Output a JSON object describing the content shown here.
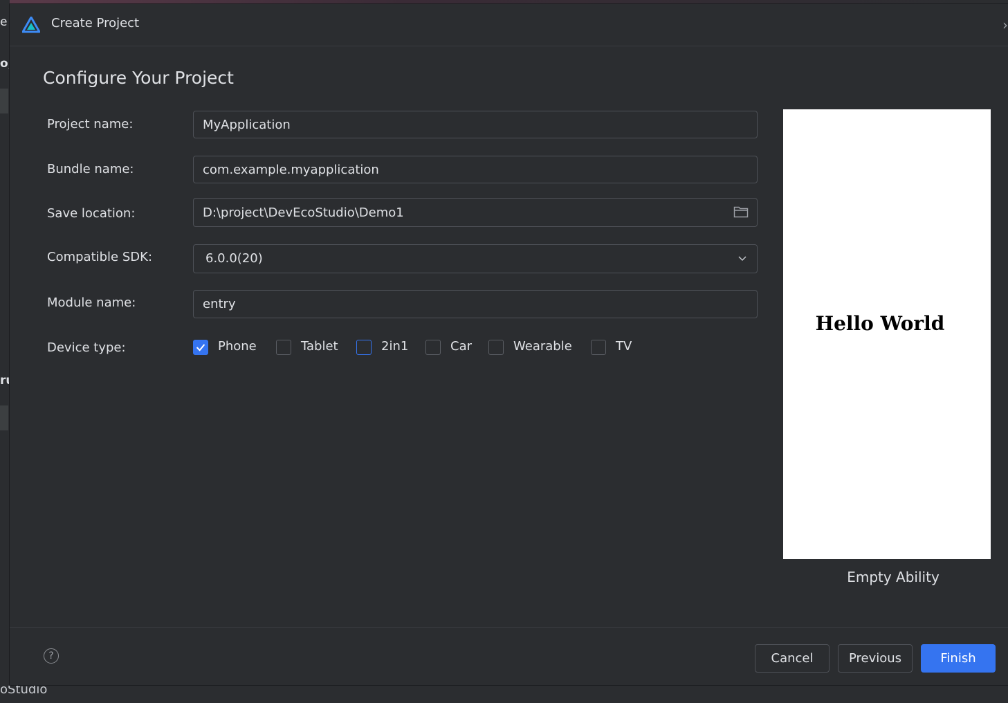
{
  "background": {
    "fragments": [
      "e",
      "o,",
      "ru"
    ],
    "status_text": "oStudio"
  },
  "dialog": {
    "title": "Create Project",
    "heading": "Configure Your Project",
    "form": {
      "project_name": {
        "label": "Project name:",
        "value": "MyApplication"
      },
      "bundle_name": {
        "label": "Bundle name:",
        "value": "com.example.myapplication"
      },
      "save_location": {
        "label": "Save location:",
        "value": "D:\\project\\DevEcoStudio\\Demo1"
      },
      "compatible_sdk": {
        "label": "Compatible SDK:",
        "value": "6.0.0(20)"
      },
      "module_name": {
        "label": "Module name:",
        "value": "entry"
      },
      "device_type": {
        "label": "Device type:",
        "options": [
          {
            "label": "Phone",
            "checked": true
          },
          {
            "label": "Tablet",
            "checked": false
          },
          {
            "label": "2in1",
            "checked": false
          },
          {
            "label": "Car",
            "checked": false
          },
          {
            "label": "Wearable",
            "checked": false
          },
          {
            "label": "TV",
            "checked": false
          }
        ]
      }
    },
    "preview": {
      "screen_text": "Hello World",
      "caption": "Empty Ability"
    },
    "buttons": {
      "help": "?",
      "cancel": "Cancel",
      "previous": "Previous",
      "finish": "Finish"
    },
    "colors": {
      "accent": "#3574f0",
      "background": "#2b2d30",
      "border": "#4e5157"
    }
  }
}
